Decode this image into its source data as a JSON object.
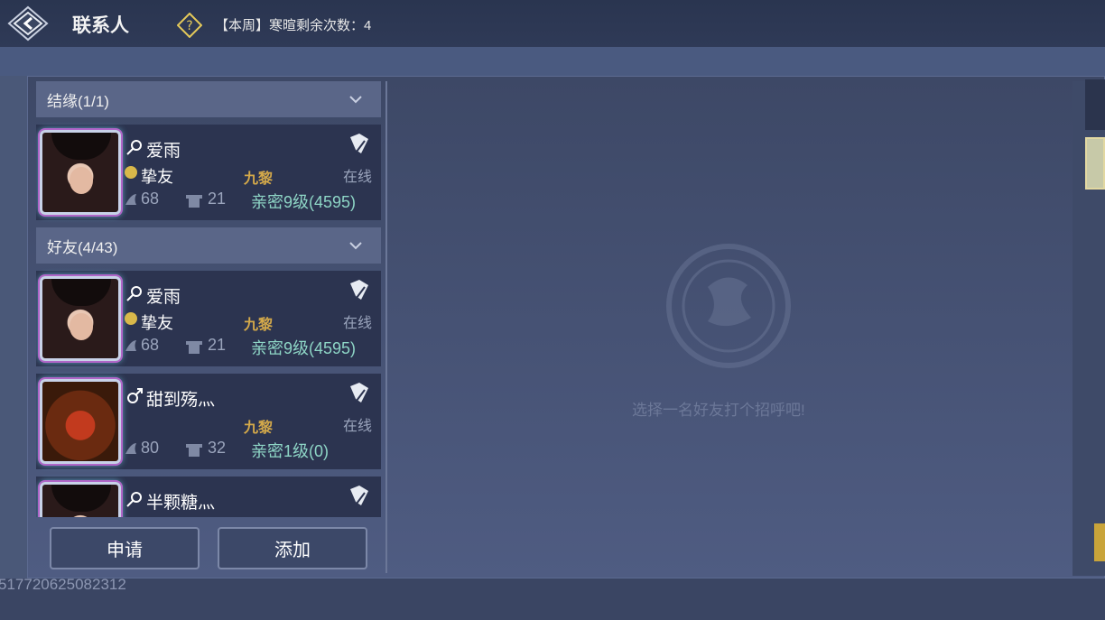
{
  "header": {
    "title": "联系人",
    "greet_text": "【本周】寒暄剩余次数：4"
  },
  "sections": [
    {
      "label": "结缘(1/1)"
    },
    {
      "label": "好友(4/43)"
    }
  ],
  "contacts": [
    {
      "name": "爱雨",
      "relation": "挚友",
      "guild": "九黎",
      "status": "在线",
      "level": "68",
      "house": "21",
      "intimacy": "亲密9级(4595)"
    },
    {
      "name": "爱雨",
      "relation": "挚友",
      "guild": "九黎",
      "status": "在线",
      "level": "68",
      "house": "21",
      "intimacy": "亲密9级(4595)"
    },
    {
      "name": "甜到殇灬",
      "relation": "",
      "guild": "九黎",
      "status": "在线",
      "level": "80",
      "house": "32",
      "intimacy": "亲密1级(0)"
    },
    {
      "name": "半颗糖灬"
    }
  ],
  "buttons": {
    "apply": "申请",
    "add": "添加"
  },
  "empty_state": {
    "text": "选择一名好友打个招呼吧!"
  },
  "uid": "517720625082312",
  "colors": {
    "gold": "#d4a94a",
    "intimacy": "#8ed6c6",
    "panel": "#4a5878"
  }
}
